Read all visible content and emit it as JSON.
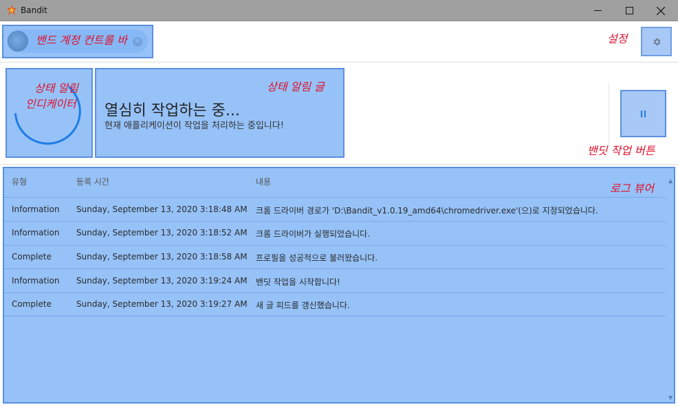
{
  "window": {
    "title": "Bandit"
  },
  "status": {
    "title": "열심히 작업하는 중...",
    "description": "현재 애플리케이션이 작업을 처리하는 중입니다!"
  },
  "log": {
    "columns": [
      "유형",
      "등록 시간",
      "내용"
    ],
    "rows": [
      {
        "type": "Information",
        "time": "Sunday, September 13, 2020 3:18:48 AM",
        "content": "크롬 드라이버 경로가 'D:\\Bandit_v1.0.19_amd64\\chromedriver.exe'(으)로 지정되었습니다."
      },
      {
        "type": "Information",
        "time": "Sunday, September 13, 2020 3:18:52 AM",
        "content": "크롬 드라이버가 실행되었습니다."
      },
      {
        "type": "Complete",
        "time": "Sunday, September 13, 2020 3:18:58 AM",
        "content": "프로필을 성공적으로 불러왔습니다."
      },
      {
        "type": "Information",
        "time": "Sunday, September 13, 2020 3:19:24 AM",
        "content": "밴딧 작업을 시작합니다!"
      },
      {
        "type": "Complete",
        "time": "Sunday, September 13, 2020 3:19:27 AM",
        "content": "새 글 피드를 갱신했습니다."
      }
    ]
  },
  "annotations": {
    "account_bar": "밴드 계정 컨트롤 바",
    "settings": "설정",
    "indicator_line1": "상태 알림",
    "indicator_line2": "인디케이터",
    "status_text": "상태 알림 글",
    "bandit_button": "밴딧 작업 버튼",
    "log_viewer": "로그 뷰어"
  },
  "icons": {
    "app": "bandit-app-icon",
    "settings": "gear-icon",
    "pause": "pause-icon",
    "clear": "close-icon"
  },
  "colors": {
    "accent": "#1e7be6",
    "highlight": "#6eaaf5",
    "annotation": "#e0102a"
  }
}
